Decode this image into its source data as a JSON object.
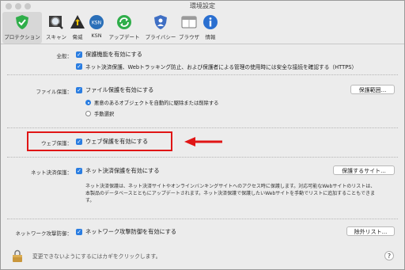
{
  "window": {
    "title": "環境設定"
  },
  "toolbar": {
    "items": [
      {
        "label": "プロテクション",
        "icon": "shield-check-icon"
      },
      {
        "label": "スキャン",
        "icon": "magnifier-icon"
      },
      {
        "label": "脅威",
        "icon": "warning-icon"
      },
      {
        "label": "KSN",
        "icon": "ksn-icon"
      },
      {
        "label": "アップデート",
        "icon": "update-icon"
      },
      {
        "label": "プライバシー",
        "icon": "privacy-icon"
      },
      {
        "label": "ブラウザ",
        "icon": "browser-icon"
      },
      {
        "label": "情報",
        "icon": "info-icon"
      }
    ]
  },
  "general": {
    "label": "全般：",
    "option1": "保護機能を有効にする",
    "option2": "ネット決済保護、Webトラッキング防止、および保護者による管理の使用時には安全な接続を確認する（HTTPS）"
  },
  "file_protection": {
    "label": "ファイル保護：",
    "checkbox": "ファイル保護を有効にする",
    "button": "保護範囲...",
    "radio1": "悪意のあるオブジェクトを自動的に駆除または削除する",
    "radio2": "手動選択"
  },
  "web_protection": {
    "label": "ウェブ保護：",
    "checkbox": "ウェブ保護を有効にする"
  },
  "safe_money": {
    "label": "ネット決済保護：",
    "checkbox": "ネット決済保護を有効にする",
    "button": "保護するサイト...",
    "desc1": "ネット決済保護は、ネット決済サイトやオンラインバンキングサイトへのアクセス時に保護します。対応可能なWebサイトのリストは、",
    "desc2": "本製品のデータベースとともにアップデートされます。ネット決済保護で保護したいWebサイトを手動でリストに追加することもできま",
    "desc3": "す。"
  },
  "network_attack": {
    "label": "ネットワーク攻撃防御：",
    "checkbox": "ネットワーク攻撃防御を有効にする",
    "button": "除外リスト..."
  },
  "footer": {
    "lock_text": "変更できないようにするにはカギをクリックします。",
    "help": "?"
  },
  "colors": {
    "accent": "#2a7de1",
    "highlight": "#e01515",
    "shield": "#2fae4a"
  }
}
